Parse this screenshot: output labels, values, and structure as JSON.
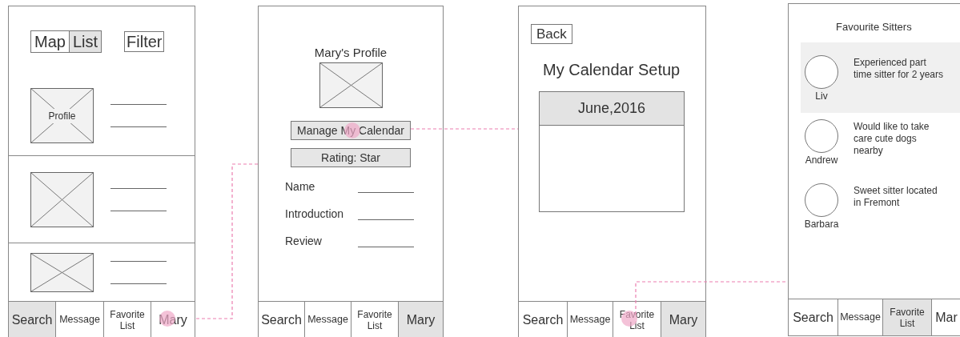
{
  "screens": [
    {
      "kind": "search",
      "toggle": [
        {
          "label": "Map",
          "selected": false
        },
        {
          "label": "List",
          "selected": true
        }
      ],
      "filter": "Filter",
      "cards": [
        {
          "kind": "labeled",
          "image_label": "Profile"
        },
        {
          "kind": "plain"
        },
        {
          "kind": "short"
        }
      ],
      "tabs": [
        {
          "label": "Search",
          "selected": true,
          "tapped": false
        },
        {
          "label": "Message",
          "selected": false,
          "tapped": false
        },
        {
          "label": "Favorite List",
          "selected": false,
          "tapped": false
        },
        {
          "label": "Mary",
          "selected": false,
          "tapped": true
        }
      ]
    },
    {
      "kind": "profile",
      "title": "Mary's Profile",
      "buttons": [
        {
          "label": "Manage My Calendar",
          "tapped": true
        },
        {
          "label": "Rating: Star",
          "tapped": false
        }
      ],
      "fields": [
        "Name",
        "Introduction",
        "Review"
      ],
      "tabs": [
        {
          "label": "Search",
          "selected": false,
          "tapped": false
        },
        {
          "label": "Message",
          "selected": false,
          "tapped": false
        },
        {
          "label": "Favorite List",
          "selected": false,
          "tapped": false
        },
        {
          "label": "Mary",
          "selected": true,
          "tapped": false
        }
      ]
    },
    {
      "kind": "calendar",
      "back": "Back",
      "title": "My Calendar Setup",
      "month": "June,2016",
      "tabs": [
        {
          "label": "Search",
          "selected": false,
          "tapped": false
        },
        {
          "label": "Message",
          "selected": false,
          "tapped": false
        },
        {
          "label": "Favorite List",
          "selected": false,
          "tapped": true
        },
        {
          "label": "Mary",
          "selected": true,
          "tapped": false
        }
      ]
    },
    {
      "kind": "favourites",
      "title": "Favourite Sitters",
      "sitters": [
        {
          "name": "Liv",
          "description": "Experienced part time sitter for 2 years",
          "selected": true
        },
        {
          "name": "Andrew",
          "description": "Would like to take care cute dogs nearby",
          "selected": false
        },
        {
          "name": "Barbara",
          "description": "Sweet sitter located in Fremont",
          "selected": false
        }
      ],
      "tabs": [
        {
          "label": "Search",
          "selected": false,
          "tapped": false
        },
        {
          "label": "Message",
          "selected": false,
          "tapped": false
        },
        {
          "label": "Favorite List",
          "selected": true,
          "tapped": false
        },
        {
          "label": "Mar",
          "selected": false,
          "tapped": false
        }
      ]
    }
  ]
}
